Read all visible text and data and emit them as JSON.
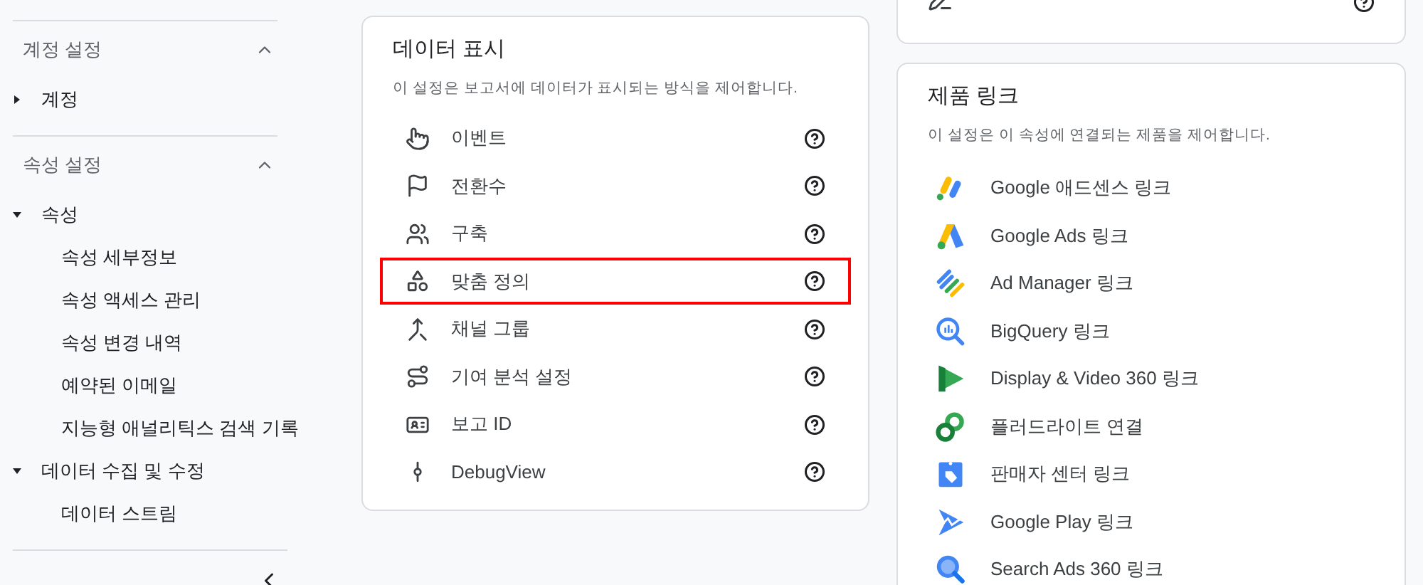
{
  "sidebar": {
    "sections": [
      {
        "title": "계정 설정",
        "expanded": true,
        "items": [
          {
            "label": "계정",
            "expanded": false
          }
        ]
      },
      {
        "title": "속성 설정",
        "expanded": true,
        "items": [
          {
            "label": "속성",
            "expanded": true,
            "children": [
              {
                "label": "속성 세부정보"
              },
              {
                "label": "속성 액세스 관리"
              },
              {
                "label": "속성 변경 내역"
              },
              {
                "label": "예약된 이메일"
              },
              {
                "label": "지능형 애널리틱스 검색 기록"
              }
            ]
          },
          {
            "label": "데이터 수집 및 수정",
            "expanded": true,
            "children": [
              {
                "label": "데이터 스트림"
              }
            ]
          }
        ]
      }
    ]
  },
  "data_display": {
    "title": "데이터 표시",
    "subtitle": "이 설정은 보고서에 데이터가 표시되는 방식을 제어합니다.",
    "items": [
      {
        "label": "이벤트",
        "highlighted": false
      },
      {
        "label": "전환수",
        "highlighted": false
      },
      {
        "label": "구축",
        "highlighted": false
      },
      {
        "label": "맞춤 정의",
        "highlighted": true
      },
      {
        "label": "채널 그룹",
        "highlighted": false
      },
      {
        "label": "기여 분석 설정",
        "highlighted": false
      },
      {
        "label": "보고 ID",
        "highlighted": false
      },
      {
        "label": "DebugView",
        "highlighted": false
      }
    ]
  },
  "product_links": {
    "title": "제품 링크",
    "subtitle": "이 설정은 이 속성에 연결되는 제품을 제어합니다.",
    "items": [
      {
        "label": "Google 애드센스 링크"
      },
      {
        "label": "Google Ads 링크"
      },
      {
        "label": "Ad Manager 링크"
      },
      {
        "label": "BigQuery 링크"
      },
      {
        "label": "Display & Video 360 링크"
      },
      {
        "label": "플러드라이트 연결"
      },
      {
        "label": "판매자 센터 링크"
      },
      {
        "label": "Google Play 링크"
      },
      {
        "label": "Search Ads 360 링크"
      }
    ]
  }
}
